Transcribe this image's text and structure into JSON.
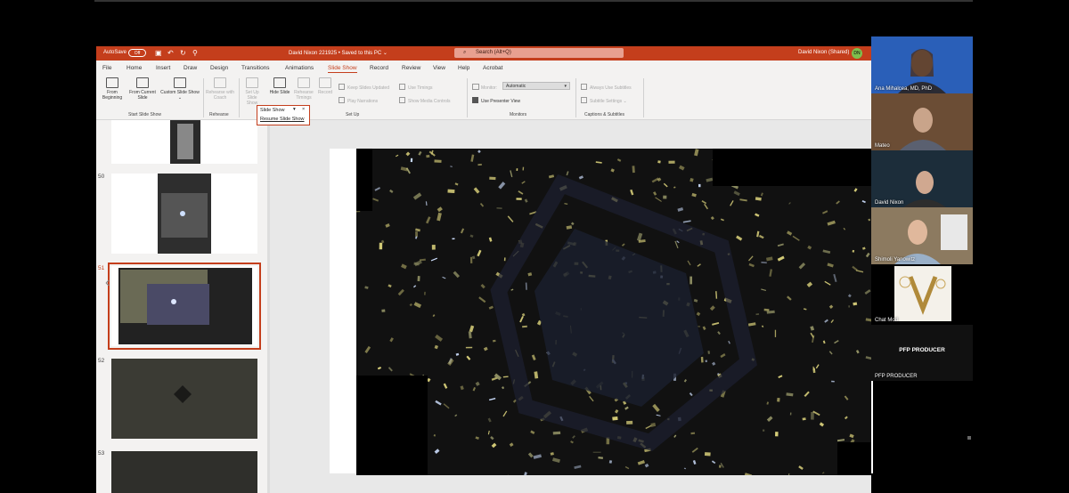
{
  "window": {
    "autosave_label": "AutoSave",
    "autosave_state": "Off",
    "doc_title": "David Nixon 221925 • Saved to this PC ⌄",
    "search_placeholder": "Search (Alt+Q)",
    "user_name": "David Nixon (Shared)",
    "user_initials": "DN"
  },
  "tabs": [
    "File",
    "Home",
    "Insert",
    "Draw",
    "Design",
    "Transitions",
    "Animations",
    "Slide Show",
    "Record",
    "Review",
    "View",
    "Help",
    "Acrobat"
  ],
  "ribbon": {
    "from_beginning": "From Beginning",
    "from_current": "From Current Slide",
    "custom_show": "Custom Slide Show ⌄",
    "group_start": "Start Slide Show",
    "rehearse_coach": "Rehearse with Coach",
    "group_rehearse": "Rehearse",
    "setup_show": "Set Up Slide Show",
    "hide_slide": "Hide Slide",
    "rehearse_timings": "Rehearse Timings",
    "record": "Record",
    "keep_updated": "Keep Slides Updated",
    "use_timings": "Use Timings",
    "play_narrations": "Play Narrations",
    "show_media": "Show Media Controls",
    "group_setup": "Set Up",
    "monitor_label": "Monitor:",
    "monitor_value": "Automatic",
    "presenter_view": "Use Presenter View",
    "group_monitors": "Monitors",
    "always_subtitles": "Always Use Subtitles",
    "subtitle_settings": "Subtitle Settings ⌄",
    "group_captions": "Captions & Subtitles"
  },
  "popup": {
    "title": "Slide Show",
    "item": "Resume Slide Show"
  },
  "slides": [
    "50",
    "51",
    "52",
    "53"
  ],
  "participants": [
    {
      "name": "Ana Mihalcea, MD, PhD",
      "color": "#2a5fb8"
    },
    {
      "name": "Mateo",
      "color": "#4a3a2a"
    },
    {
      "name": "David Nixon",
      "color": "#1e2a33"
    },
    {
      "name": "Shimoli Yanowitz",
      "color": "#7a6a52"
    },
    {
      "name": "Chat Mod",
      "color": "#000000"
    },
    {
      "name": "PFP PRODUCER",
      "color": "#111111"
    }
  ],
  "producer_caption": "PFP PRODUCER",
  "colors": {
    "accent": "#c43e1c",
    "monitor_icon": "#2a6fdb"
  }
}
